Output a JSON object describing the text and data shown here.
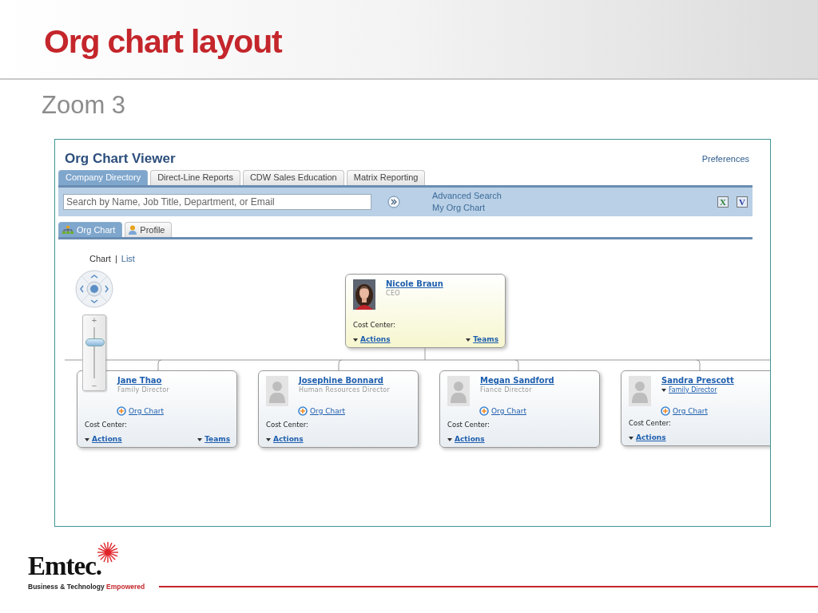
{
  "slide": {
    "title": "Org chart layout",
    "subtitle": "Zoom 3"
  },
  "viewer": {
    "title": "Org Chart Viewer",
    "preferences": "Preferences",
    "tabs": [
      {
        "label": "Company Directory",
        "selected": true
      },
      {
        "label": "Direct-Line Reports",
        "selected": false
      },
      {
        "label": "CDW Sales Education",
        "selected": false
      },
      {
        "label": "Matrix Reporting",
        "selected": false
      }
    ],
    "search": {
      "placeholder": "Search by Name, Job Title, Department, or Email"
    },
    "links": [
      "Advanced Search",
      "My Org Chart"
    ],
    "exports": [
      {
        "letter": "X",
        "color": "#2e7d32"
      },
      {
        "letter": "V",
        "color": "#2a3f9e"
      }
    ],
    "subtabs": [
      {
        "label": "Org Chart",
        "selected": true
      },
      {
        "label": "Profile",
        "selected": false
      }
    ],
    "views": [
      {
        "label": "Chart",
        "selected": true
      },
      {
        "label": "List",
        "selected": false
      }
    ],
    "view_separator": "|",
    "zoom_slider": {
      "level": 0.7,
      "plus": "+",
      "minus": "−"
    },
    "root": {
      "name": "Nicole Braun",
      "title": "CEO",
      "title_link": false,
      "kind": "portrait",
      "highlighted": true,
      "cost_center": "Cost Center:",
      "actions": "Actions",
      "teams": "Teams"
    },
    "reports": [
      {
        "name": "Jane Thao",
        "title": "Family Director",
        "title_link": false,
        "kind": "none",
        "highlighted": false,
        "org_chart": "Org Chart",
        "cost_center": "Cost Center:",
        "actions": "Actions",
        "teams": "Teams"
      },
      {
        "name": "Josephine Bonnard",
        "title": "Human Resources Director",
        "title_link": false,
        "kind": "placeholder",
        "highlighted": false,
        "org_chart": "Org Chart",
        "cost_center": "Cost Center:",
        "actions": "Actions"
      },
      {
        "name": "Megan Sandford",
        "title": "Fiance Director",
        "title_link": false,
        "kind": "placeholder",
        "highlighted": false,
        "org_chart": "Org Chart",
        "cost_center": "Cost Center:",
        "actions": "Actions"
      },
      {
        "name": "Sandra Prescott",
        "title": "Family Director",
        "title_link": true,
        "kind": "placeholder",
        "highlighted": false,
        "org_chart": "Org Chart",
        "cost_center": "Cost Center:",
        "actions": "Actions"
      }
    ]
  },
  "footer": {
    "logo": "Emtec.",
    "tagline": "Business & Technology",
    "tagline_accent": "Empowered"
  }
}
